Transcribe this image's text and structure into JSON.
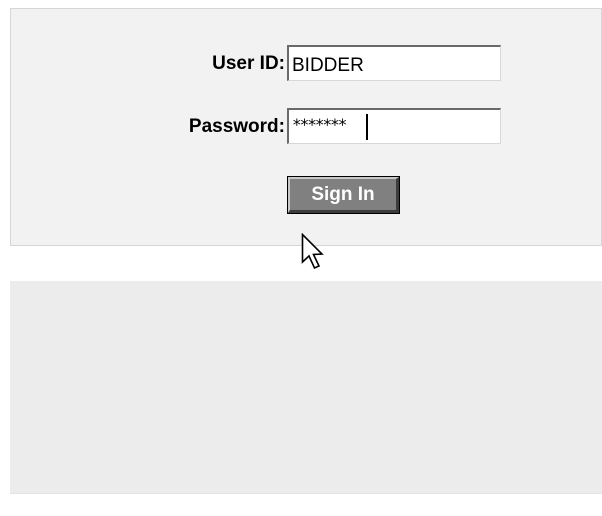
{
  "login": {
    "user_id_label": "User ID:",
    "user_id_value": "BIDDER",
    "password_label": "Password:",
    "password_masked": "*******",
    "signin_label": "Sign In"
  },
  "icons": {
    "cursor": "mouse-pointer-arrow"
  },
  "colors": {
    "panel_background": "#f2f2f2",
    "lower_panel_background": "#ececec",
    "button_background": "#808080",
    "button_text": "#ffffff"
  }
}
